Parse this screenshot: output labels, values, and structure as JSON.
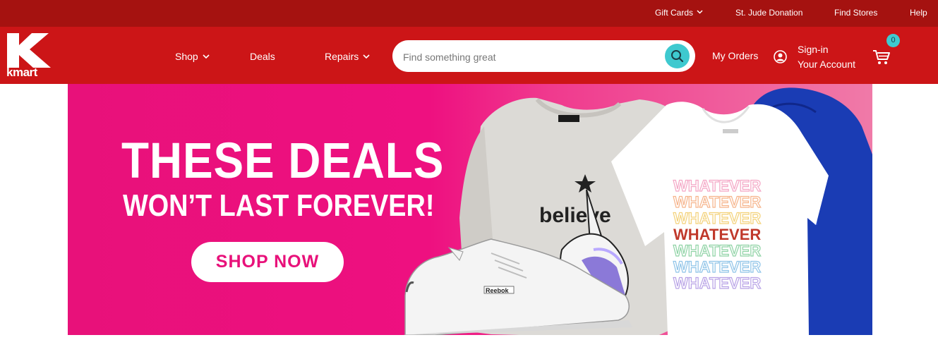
{
  "topbar": {
    "links": [
      {
        "label": "Gift Cards",
        "has_dropdown": true
      },
      {
        "label": "St. Jude Donation"
      },
      {
        "label": "Find Stores"
      },
      {
        "label": "Help"
      }
    ]
  },
  "header": {
    "logo_text": "kmart",
    "nav": [
      {
        "label": "Shop",
        "has_dropdown": true
      },
      {
        "label": "Deals"
      },
      {
        "label": "Repairs",
        "has_dropdown": true
      }
    ],
    "search": {
      "placeholder": "Find something great",
      "value": ""
    },
    "my_orders": "My Orders",
    "signin_line1": "Sign-in",
    "signin_line2": "Your Account",
    "cart_count": "0"
  },
  "banner": {
    "headline_line1": "THESE DEALS",
    "headline_line2": "WON’T LAST FOREVER!",
    "cta": "SHOP NOW",
    "sweatshirt_text": "believe",
    "tshirt_text": "WHATEVER",
    "shoe_brand": "Reebok"
  },
  "colors": {
    "topbar": "#a51210",
    "mainbar": "#cc1517",
    "accent_teal": "#3ec9cf",
    "banner_pink": "#e8117a"
  }
}
